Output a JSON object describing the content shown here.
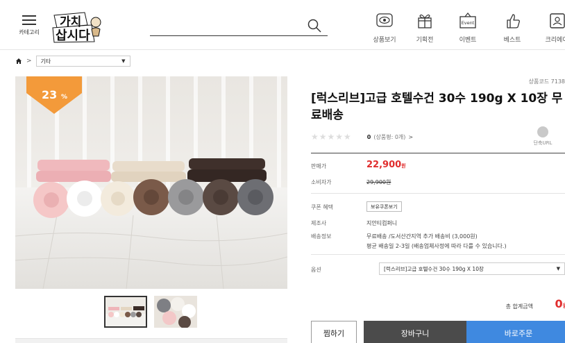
{
  "header": {
    "menu_label": "카테고리",
    "logo_line1": "가치",
    "logo_line2": "삽시다",
    "search_placeholder": "",
    "nav": [
      {
        "icon": "eye-icon",
        "label": "상품보기"
      },
      {
        "icon": "gift-icon",
        "label": "기획전"
      },
      {
        "icon": "event-icon",
        "label": "이벤트",
        "icon_text": "Event"
      },
      {
        "icon": "thumbs-up-icon",
        "label": "베스트"
      },
      {
        "icon": "creator-icon",
        "label": "크리에이"
      }
    ]
  },
  "breadcrumb": {
    "separator": ">",
    "category": "기타"
  },
  "image": {
    "discount_badge": "23",
    "discount_unit": "%",
    "badge_color": "#f39a3a"
  },
  "product": {
    "code": "상품코드 7138",
    "title": "[럭스리브]고급 호텔수건 30수 190g X 10장 무료배송",
    "stars": "★★★★★",
    "review_count": "0",
    "review_text": "(상품평: 0개)",
    "review_arrow": ">",
    "short_url_label": "단축URL",
    "price_label": "판매가",
    "price": "22,900",
    "price_unit": "원",
    "consumer_label": "소비자가",
    "consumer_price": "29,900원",
    "coupon_label": "쿠폰 혜택",
    "coupon_button": "보유쿠폰보기",
    "maker_label": "제조사",
    "maker": "지안티컴퍼니",
    "shipping_label": "배송정보",
    "shipping_line1": "무료배송 /도서산간지역 추가 배송비 (3,000원)",
    "shipping_line2": "평균 배송일 2-3일 (배송업체사정에 따라 다를 수 있습니다.)",
    "option_label": "옵션",
    "option_value": "[럭스리브]고급 호텔수건 30수 190g X 10장",
    "total_label": "총 합계금액",
    "total_value": "0",
    "total_unit": "원"
  },
  "buttons": {
    "wish": "찜하기",
    "cart": "장바구니",
    "buy": "바로주문"
  },
  "colors": {
    "accent_red": "#e02d2d",
    "buy_blue": "#3f89e0",
    "cart_gray": "#4b4b4b"
  }
}
